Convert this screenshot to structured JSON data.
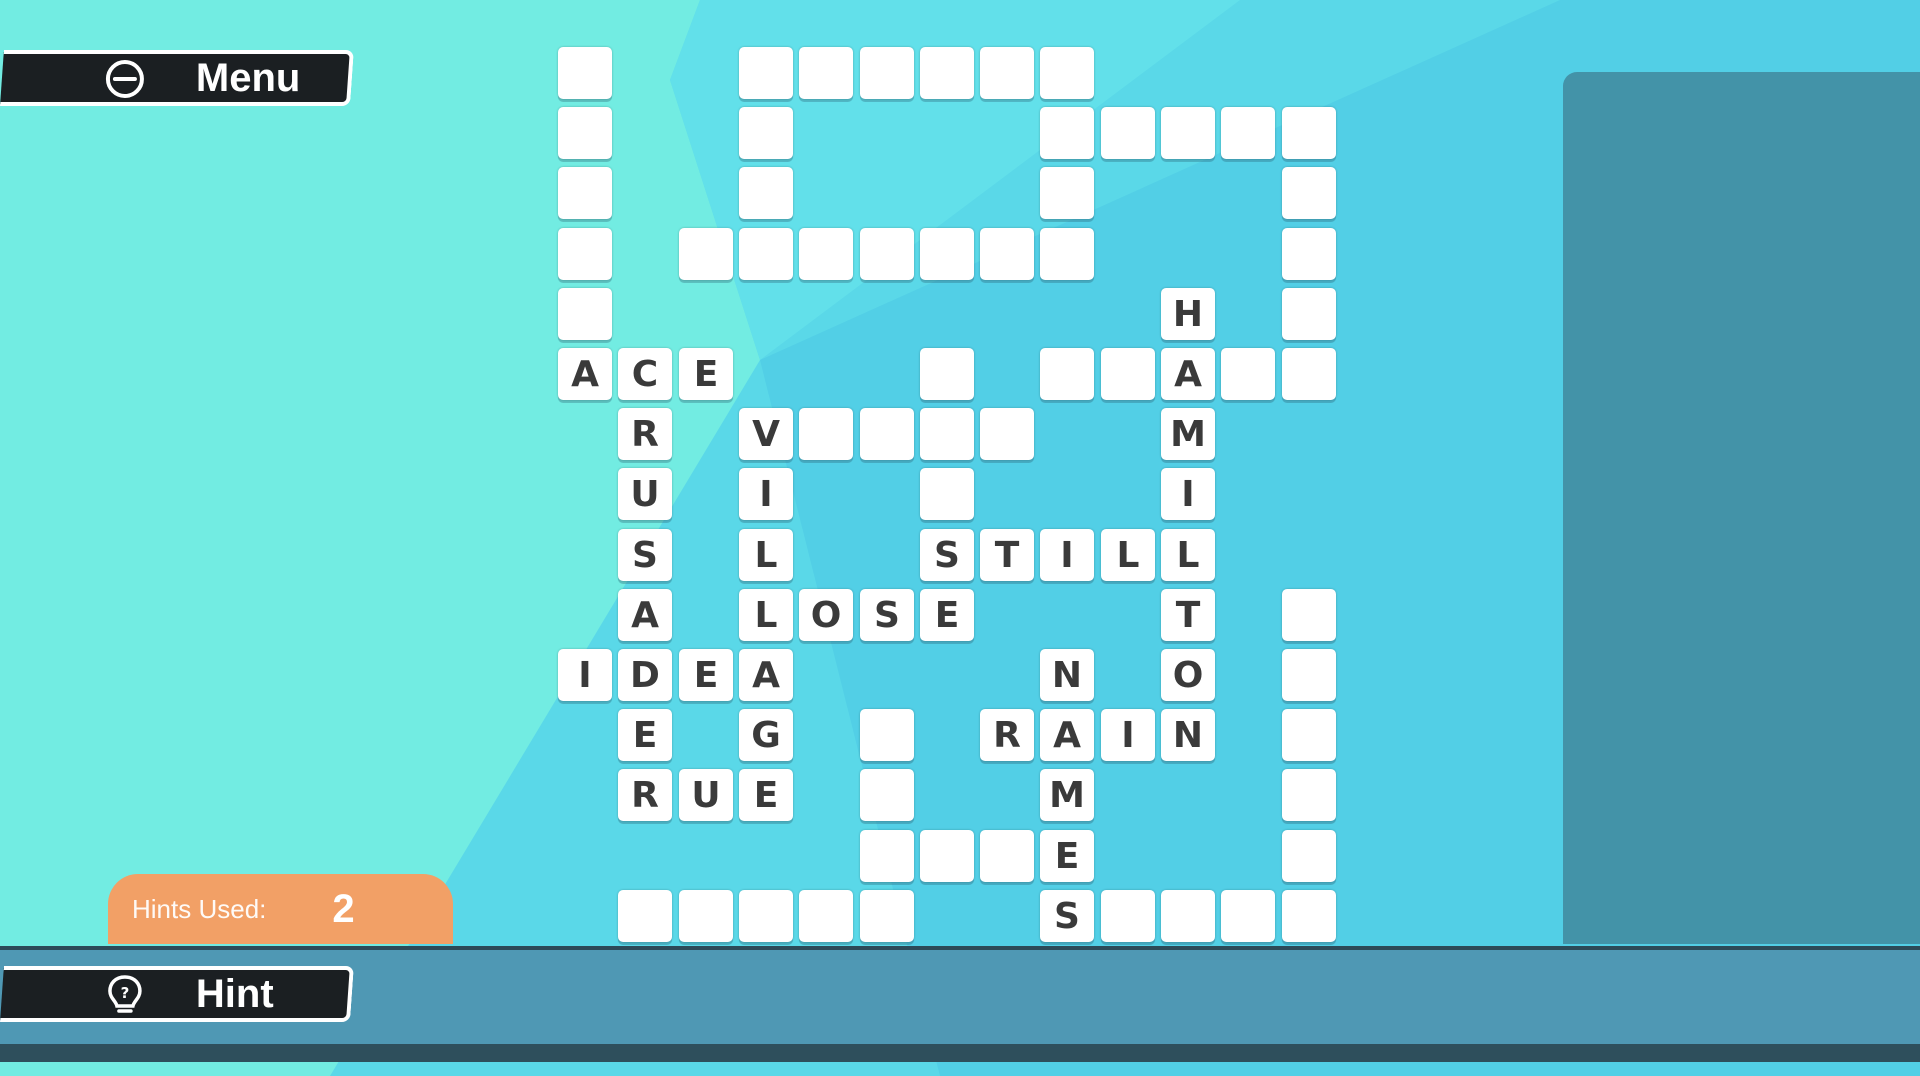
{
  "menu": {
    "label": "Menu",
    "icon": "menu-icon"
  },
  "hint": {
    "label": "Hint",
    "icon": "hint-bulb-icon"
  },
  "hints_used": {
    "label": "Hints Used:",
    "count": "2"
  },
  "colors": {
    "background": "#5ad8e8",
    "background_light": "#72ece2",
    "tile": "#ffffff",
    "letter": "#3a3a3a",
    "hints_panel": "#f2a066",
    "bottom_bar": "#4f98b4",
    "side_panel": "#4393a8",
    "button": "#1b1f22"
  },
  "crossword": {
    "cells": [
      [
        0,
        0,
        ""
      ],
      [
        0,
        3,
        ""
      ],
      [
        0,
        4,
        ""
      ],
      [
        0,
        5,
        ""
      ],
      [
        0,
        6,
        ""
      ],
      [
        0,
        7,
        ""
      ],
      [
        0,
        8,
        ""
      ],
      [
        1,
        0,
        ""
      ],
      [
        1,
        3,
        ""
      ],
      [
        1,
        8,
        ""
      ],
      [
        1,
        9,
        ""
      ],
      [
        1,
        10,
        ""
      ],
      [
        1,
        11,
        ""
      ],
      [
        1,
        12,
        ""
      ],
      [
        2,
        0,
        ""
      ],
      [
        2,
        3,
        ""
      ],
      [
        2,
        8,
        ""
      ],
      [
        2,
        12,
        ""
      ],
      [
        3,
        0,
        ""
      ],
      [
        3,
        2,
        ""
      ],
      [
        3,
        3,
        ""
      ],
      [
        3,
        4,
        ""
      ],
      [
        3,
        5,
        ""
      ],
      [
        3,
        6,
        ""
      ],
      [
        3,
        7,
        ""
      ],
      [
        3,
        8,
        ""
      ],
      [
        3,
        12,
        ""
      ],
      [
        4,
        0,
        ""
      ],
      [
        4,
        10,
        "H"
      ],
      [
        4,
        12,
        ""
      ],
      [
        5,
        0,
        "A"
      ],
      [
        5,
        1,
        "C"
      ],
      [
        5,
        2,
        "E"
      ],
      [
        5,
        6,
        ""
      ],
      [
        5,
        8,
        ""
      ],
      [
        5,
        9,
        ""
      ],
      [
        5,
        10,
        "A"
      ],
      [
        5,
        11,
        ""
      ],
      [
        5,
        12,
        ""
      ],
      [
        6,
        1,
        "R"
      ],
      [
        6,
        3,
        "V"
      ],
      [
        6,
        4,
        ""
      ],
      [
        6,
        5,
        ""
      ],
      [
        6,
        6,
        ""
      ],
      [
        6,
        7,
        ""
      ],
      [
        6,
        10,
        "M"
      ],
      [
        7,
        1,
        "U"
      ],
      [
        7,
        3,
        "I"
      ],
      [
        7,
        6,
        ""
      ],
      [
        7,
        10,
        "I"
      ],
      [
        8,
        1,
        "S"
      ],
      [
        8,
        3,
        "L"
      ],
      [
        8,
        6,
        "S"
      ],
      [
        8,
        7,
        "T"
      ],
      [
        8,
        8,
        "I"
      ],
      [
        8,
        9,
        "L"
      ],
      [
        8,
        10,
        "L"
      ],
      [
        9,
        1,
        "A"
      ],
      [
        9,
        3,
        "L"
      ],
      [
        9,
        4,
        "O"
      ],
      [
        9,
        5,
        "S"
      ],
      [
        9,
        6,
        "E"
      ],
      [
        9,
        10,
        "T"
      ],
      [
        9,
        12,
        ""
      ],
      [
        10,
        0,
        "I"
      ],
      [
        10,
        1,
        "D"
      ],
      [
        10,
        2,
        "E"
      ],
      [
        10,
        3,
        "A"
      ],
      [
        10,
        8,
        "N"
      ],
      [
        10,
        10,
        "O"
      ],
      [
        10,
        12,
        ""
      ],
      [
        11,
        1,
        "E"
      ],
      [
        11,
        3,
        "G"
      ],
      [
        11,
        5,
        ""
      ],
      [
        11,
        7,
        "R"
      ],
      [
        11,
        8,
        "A"
      ],
      [
        11,
        9,
        "I"
      ],
      [
        11,
        10,
        "N"
      ],
      [
        11,
        12,
        ""
      ],
      [
        12,
        1,
        "R"
      ],
      [
        12,
        2,
        "U"
      ],
      [
        12,
        3,
        "E"
      ],
      [
        12,
        5,
        ""
      ],
      [
        12,
        8,
        "M"
      ],
      [
        12,
        12,
        ""
      ],
      [
        13,
        5,
        ""
      ],
      [
        13,
        6,
        ""
      ],
      [
        13,
        7,
        ""
      ],
      [
        13,
        8,
        "E"
      ],
      [
        13,
        12,
        ""
      ],
      [
        14,
        1,
        ""
      ],
      [
        14,
        2,
        ""
      ],
      [
        14,
        3,
        ""
      ],
      [
        14,
        4,
        ""
      ],
      [
        14,
        5,
        ""
      ],
      [
        14,
        8,
        "S"
      ],
      [
        14,
        9,
        ""
      ],
      [
        14,
        10,
        ""
      ],
      [
        14,
        11,
        ""
      ],
      [
        14,
        12,
        ""
      ]
    ]
  }
}
